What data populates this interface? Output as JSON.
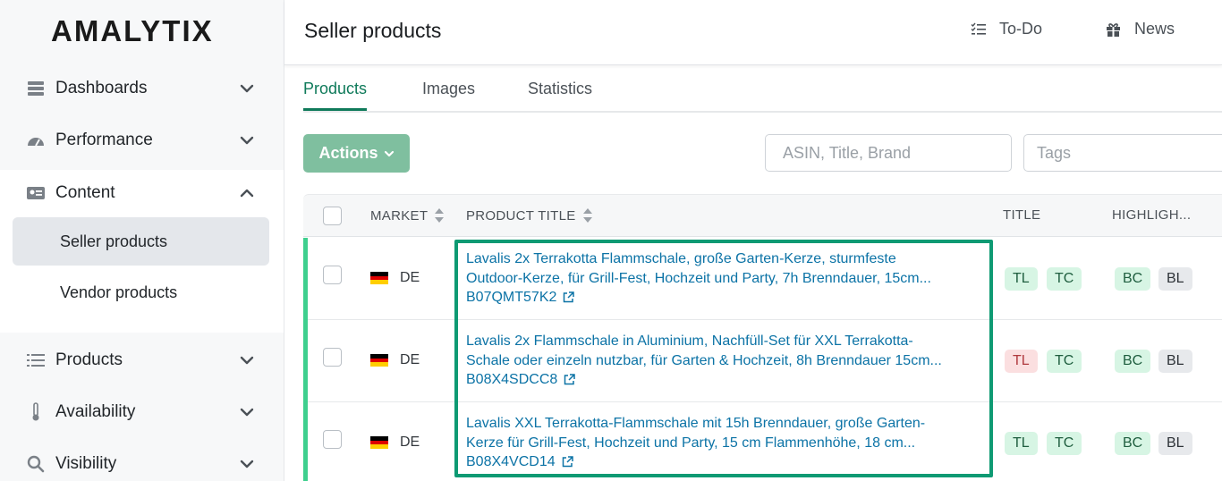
{
  "sidebar": {
    "logo": "AMALYTIX",
    "items": [
      {
        "label": "Dashboards",
        "icon": "server-icon"
      },
      {
        "label": "Performance",
        "icon": "gauge-icon"
      },
      {
        "label": "Content",
        "icon": "id-card-icon"
      },
      {
        "label": "Products",
        "icon": "list-icon"
      },
      {
        "label": "Availability",
        "icon": "thermometer-icon"
      },
      {
        "label": "Visibility",
        "icon": "search-icon"
      }
    ],
    "content_sub": [
      {
        "label": "Seller products",
        "active": true
      },
      {
        "label": "Vendor products",
        "active": false
      }
    ]
  },
  "header": {
    "title": "Seller products",
    "todo_label": "To-Do",
    "news_label": "News"
  },
  "tabs": [
    {
      "label": "Products",
      "active": true
    },
    {
      "label": "Images",
      "active": false
    },
    {
      "label": "Statistics",
      "active": false
    }
  ],
  "toolbar": {
    "actions_label": "Actions",
    "search_placeholder": "ASIN, Title, Brand",
    "tags_placeholder": "Tags"
  },
  "table": {
    "columns": [
      "MARKET",
      "PRODUCT TITLE",
      "TITLE",
      "HIGHLIGH..."
    ],
    "rows": [
      {
        "market": "DE",
        "title_line1": "Lavalis 2x Terrakotta Flammschale, große Garten-Kerze, sturmfeste",
        "title_line2": "Outdoor-Kerze, für Grill-Fest, Hochzeit und Party, 7h Brenndauer, 15cm...",
        "asin": "B07QMT57K2",
        "title_badges": [
          {
            "label": "TL",
            "status": "green"
          },
          {
            "label": "TC",
            "status": "green"
          }
        ],
        "highlight_badges": [
          {
            "label": "BC",
            "status": "green"
          },
          {
            "label": "BL",
            "status": "grey"
          }
        ]
      },
      {
        "market": "DE",
        "title_line1": "Lavalis 2x Flammschale in Aluminium, Nachfüll-Set für XXL Terrakotta-",
        "title_line2": "Schale oder einzeln nutzbar, für Garten & Hochzeit, 8h Brenndauer 15cm...",
        "asin": "B08X4SDCC8",
        "title_badges": [
          {
            "label": "TL",
            "status": "red"
          },
          {
            "label": "TC",
            "status": "green"
          }
        ],
        "highlight_badges": [
          {
            "label": "BC",
            "status": "green"
          },
          {
            "label": "BL",
            "status": "grey"
          }
        ]
      },
      {
        "market": "DE",
        "title_line1": "Lavalis XXL Terrakotta-Flammschale mit 15h Brenndauer, große Garten-",
        "title_line2": "Kerze für Grill-Fest, Hochzeit und Party, 15 cm Flammenhöhe, 18 cm...",
        "asin": "B08X4VCD14",
        "title_badges": [
          {
            "label": "TL",
            "status": "green"
          },
          {
            "label": "TC",
            "status": "green"
          }
        ],
        "highlight_badges": [
          {
            "label": "BC",
            "status": "green"
          },
          {
            "label": "BL",
            "status": "grey"
          }
        ]
      }
    ]
  },
  "colors": {
    "accent_green": "#0f7a5a",
    "highlight_box": "#0e9a73",
    "link_blue": "#0c73a6"
  }
}
